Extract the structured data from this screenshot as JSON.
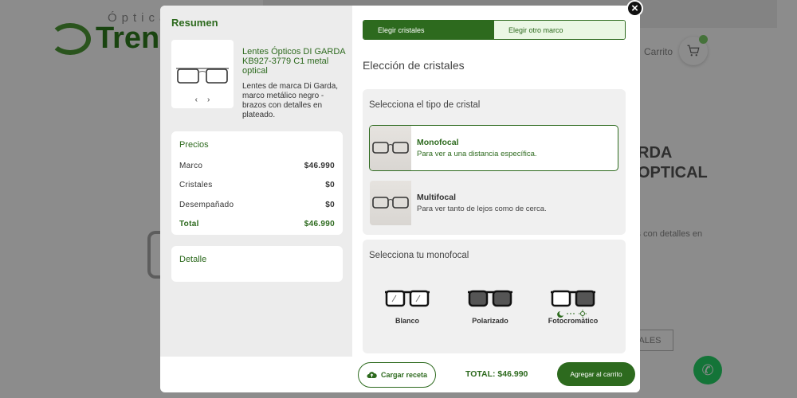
{
  "background": {
    "logo_small": "Óptica",
    "logo_large": "Trenl",
    "cart_label": "Carrito",
    "heading_line1": "RDA",
    "heading_line2": "OPTICAL",
    "description_fragment": "tcs con detalles en",
    "button_fragment": "TALES"
  },
  "summary": {
    "title": "Resumen",
    "product_name": "Lentes Ópticos DI GARDA KB927-3779 C1 metal optical",
    "product_description": "Lentes de marca Di Garda, marco metálico negro - brazos con detalles en plateado.",
    "prev_arrow": "‹",
    "next_arrow": "›",
    "prices": {
      "title": "Precios",
      "rows": [
        {
          "label": "Marco",
          "value": "$46.990"
        },
        {
          "label": "Cristales",
          "value": "$0"
        },
        {
          "label": "Desempañado",
          "value": "$0"
        }
      ],
      "total_label": "Total",
      "total_value": "$46.990"
    },
    "detail_title": "Detalle"
  },
  "tabs": [
    {
      "label": "Elegir cristales",
      "active": true
    },
    {
      "label": "Elegir otro marco",
      "active": false
    }
  ],
  "section_heading": "Elección de cristales",
  "lens_type": {
    "label": "Selecciona el tipo de cristal",
    "options": [
      {
        "name": "Monofocal",
        "description": "Para ver a una distancia específica.",
        "selected": true
      },
      {
        "name": "Multifocal",
        "description": "Para ver tanto de lejos como de cerca.",
        "selected": false
      }
    ]
  },
  "monofocal": {
    "label": "Selecciona tu monofocal",
    "options": [
      {
        "name": "Blanco",
        "icon": "clear-glasses-icon"
      },
      {
        "name": "Polarizado",
        "icon": "polarized-glasses-icon"
      },
      {
        "name": "Fotocromático",
        "icon": "photochromic-glasses-icon"
      }
    ]
  },
  "footer": {
    "upload_label": "Cargar receta",
    "total_text": "TOTAL: $46.990",
    "add_to_cart_label": "Agregar al carrito"
  },
  "colors": {
    "primary_green": "#2d6a1e",
    "light_green": "#eaf7e4"
  }
}
